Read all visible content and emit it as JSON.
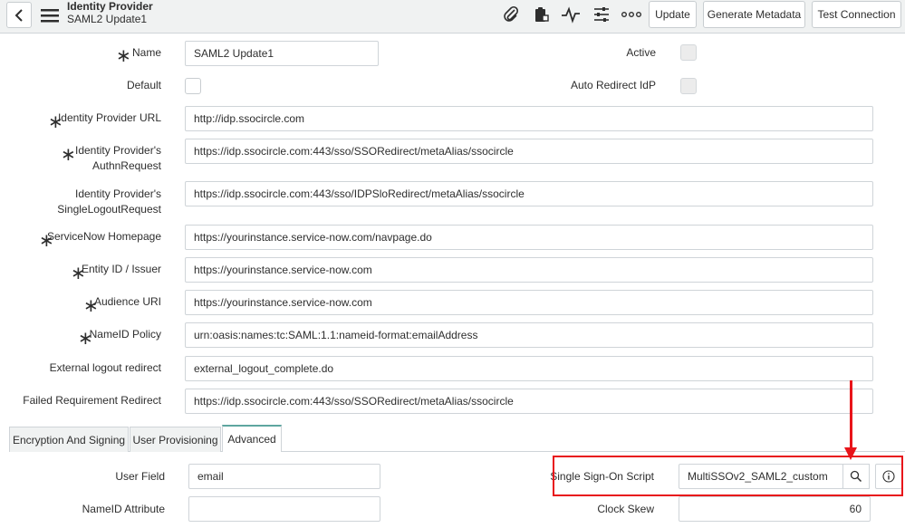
{
  "header": {
    "title": "Identity Provider",
    "subtitle": "SAML2 Update1",
    "buttons": {
      "update": "Update",
      "generate_metadata": "Generate Metadata",
      "test_connection": "Test Connection"
    },
    "icons": [
      "back-icon",
      "menu-icon",
      "paperclip-icon",
      "clipboard-icon",
      "activity-icon",
      "sliders-icon",
      "more-icon"
    ]
  },
  "form": {
    "name": {
      "label": "Name",
      "value": "SAML2 Update1",
      "required": true
    },
    "active": {
      "label": "Active",
      "checked": false
    },
    "default": {
      "label": "Default",
      "checked": false
    },
    "auto_redirect": {
      "label": "Auto Redirect IdP",
      "checked": false
    },
    "idp_url": {
      "label": "Identity Provider URL",
      "value": "http://idp.ssocircle.com",
      "required": true
    },
    "authn_request": {
      "label_line1": "Identity Provider's",
      "label_line2": "AuthnRequest",
      "value": "https://idp.ssocircle.com:443/sso/SSORedirect/metaAlias/ssocircle",
      "required": true
    },
    "logout_request": {
      "label_line1": "Identity Provider's",
      "label_line2": "SingleLogoutRequest",
      "value": "https://idp.ssocircle.com:443/sso/IDPSloRedirect/metaAlias/ssocircle"
    },
    "homepage": {
      "label": "ServiceNow Homepage",
      "value": "https://yourinstance.service-now.com/navpage.do",
      "required": true
    },
    "entity_id": {
      "label": "Entity ID / Issuer",
      "value": "https://yourinstance.service-now.com",
      "required": true
    },
    "audience": {
      "label": "Audience URI",
      "value": "https://yourinstance.service-now.com",
      "required": true
    },
    "nameid_policy": {
      "label": "NameID Policy",
      "value": "urn:oasis:names:tc:SAML:1.1:nameid-format:emailAddress",
      "required": true
    },
    "ext_logout": {
      "label": "External logout redirect",
      "value": "external_logout_complete.do"
    },
    "failed_redirect": {
      "label": "Failed Requirement Redirect",
      "value": "https://idp.ssocircle.com:443/sso/SSORedirect/metaAlias/ssocircle"
    }
  },
  "tabs": [
    {
      "label": "Encryption And Signing",
      "active": false
    },
    {
      "label": "User Provisioning",
      "active": false
    },
    {
      "label": "Advanced",
      "active": true
    }
  ],
  "advanced": {
    "user_field": {
      "label": "User Field",
      "value": "email"
    },
    "nameid_attr": {
      "label": "NameID Attribute",
      "value": ""
    },
    "sso_script": {
      "label": "Single Sign-On Script",
      "value": "MultiSSOv2_SAML2_custom"
    },
    "clock_skew": {
      "label": "Clock Skew",
      "value": "60"
    }
  },
  "colors": {
    "highlight": "#e8141a",
    "header_bg": "#f0f2f2",
    "active_tab": "#5ea6a0"
  }
}
